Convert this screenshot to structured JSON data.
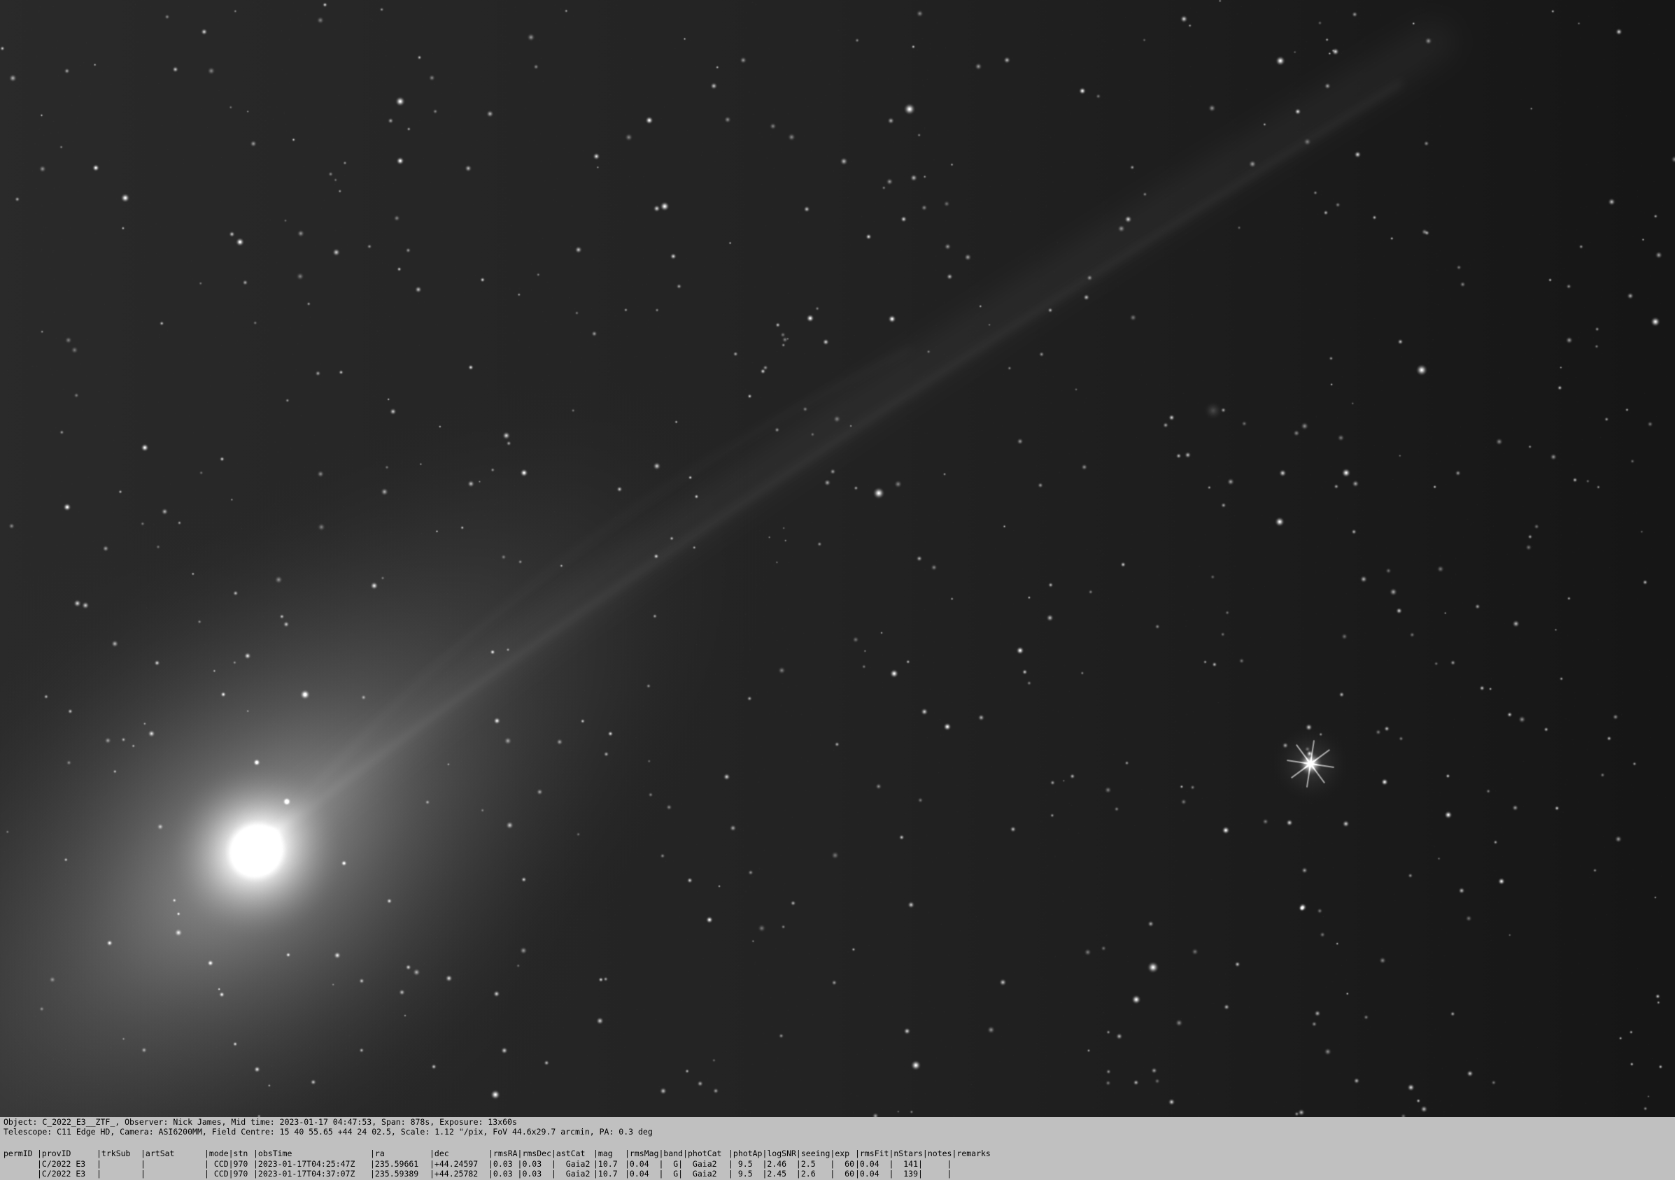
{
  "image": {
    "content": "astronomical photograph of comet with tail and star field"
  },
  "info_panel": {
    "line1": "Object: C_2022_E3__ZTF_, Observer: Nick James, Mid time: 2023-01-17 04:47:53, Span: 878s, Exposure: 13x60s",
    "line2": "Telescope: C11 Edge HD, Camera: ASI6200MM, Field Centre: 15 40 55.65 +44 24 02.5, Scale: 1.12 \"/pix, FoV 44.6x29.7 arcmin, PA: 0.3 deg",
    "table": {
      "headers": [
        "permID",
        "|provID",
        "|trkSub",
        "|artSat",
        "|mode|stn",
        "|obsTime",
        "|ra",
        "|dec",
        "|rmsRA|rmsDec|astCat",
        "|mag",
        "|rmsMag|band|photCat",
        "|photAp|logSNR|seeing|exp",
        "|rmsFit|nStars|notes|remarks"
      ],
      "rows": [
        [
          "",
          "|C/2022 E3",
          "|",
          "|",
          "| CCD|970",
          "|2023-01-17T04:25:47Z",
          "|235.59661",
          "|+44.24597",
          "|0.03 |0.03  |  Gaia2",
          "|10.7",
          "|0.04  |  G|  Gaia2",
          "| 9.5  |2.46  |2.5   |  60",
          "|0.04  |  141|     |"
        ],
        [
          "",
          "|C/2022 E3",
          "|",
          "|",
          "| CCD|970",
          "|2023-01-17T04:37:07Z",
          "|235.59389",
          "|+44.25782",
          "|0.03 |0.03  |  Gaia2",
          "|10.7",
          "|0.04  |  G|  Gaia2",
          "| 9.5  |2.45  |2.6   |  60",
          "|0.04  |  139|     |"
        ]
      ]
    }
  }
}
